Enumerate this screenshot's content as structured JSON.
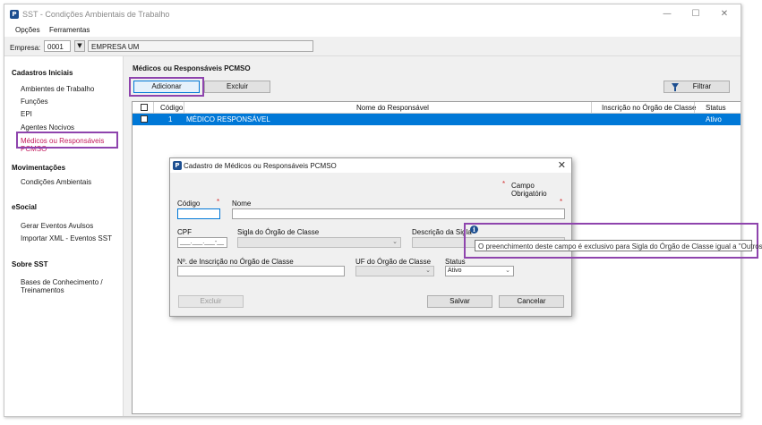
{
  "window": {
    "title": "SST - Condições Ambientais de Trabalho",
    "minimize": "—",
    "maximize": "☐",
    "close": "✕"
  },
  "menu": {
    "items": [
      "Opções",
      "Ferramentas"
    ]
  },
  "empresa": {
    "label": "Empresa:",
    "code": "0001",
    "dropdown": "▼",
    "name": "EMPRESA UM"
  },
  "sidebar": {
    "sections": [
      {
        "title": "Cadastros Iniciais",
        "items": [
          "Ambientes de Trabalho",
          "Funções",
          "EPI",
          "Agentes Nocivos",
          "Médicos ou Responsáveis PCMSO"
        ]
      },
      {
        "title": "Movimentações",
        "items": [
          "Condições Ambientais"
        ]
      },
      {
        "title": "eSocial",
        "items": [
          "Gerar Eventos Avulsos",
          "Importar XML - Eventos SST"
        ]
      },
      {
        "title": "Sobre SST",
        "items": [
          "Bases de Conhecimento / Treinamentos"
        ]
      }
    ],
    "active_item": "Médicos ou Responsáveis PCMSO"
  },
  "main": {
    "title": "Médicos ou Responsáveis PCMSO",
    "buttons": {
      "add": "Adicionar",
      "delete": "Excluir",
      "filter": "Filtrar"
    },
    "table": {
      "columns": [
        "Código",
        "Nome do Responsável",
        "Inscrição no Órgão de Classe",
        "Status"
      ],
      "rows": [
        {
          "codigo": "1",
          "nome": "MÉDICO RESPONSÁVEL",
          "inscricao": "",
          "status": "Ativo",
          "selected": true
        }
      ]
    }
  },
  "dialog": {
    "title": "Cadastro de Médicos ou Responsáveis PCMSO",
    "close": "✕",
    "required_note": "Campo Obrigatório",
    "required_mark": "*",
    "fields": {
      "codigo": {
        "label": "Código",
        "value": ""
      },
      "nome": {
        "label": "Nome",
        "value": ""
      },
      "cpf": {
        "label": "CPF",
        "value": "___.___.___-__"
      },
      "sigla": {
        "label": "Sigla do Órgão de Classe",
        "value": ""
      },
      "descricao": {
        "label": "Descrição da Sigla",
        "value": ""
      },
      "inscricao": {
        "label": "Nº. de Inscrição no Órgão de Classe",
        "value": ""
      },
      "uf": {
        "label": "UF do Órgão de Classe",
        "value": ""
      },
      "status": {
        "label": "Status",
        "value": "Ativo"
      }
    },
    "buttons": {
      "delete": "Excluir",
      "save": "Salvar",
      "cancel": "Cancelar"
    },
    "info_icon": "i",
    "tooltip": "O preenchimento deste campo é exclusivo para Sigla do Órgão de Classe igual a \"Outros\""
  },
  "colors": {
    "accent": "#0078d7",
    "highlight": "#8e44ad",
    "active_text": "#c2185b",
    "required": "#d32f2f"
  }
}
